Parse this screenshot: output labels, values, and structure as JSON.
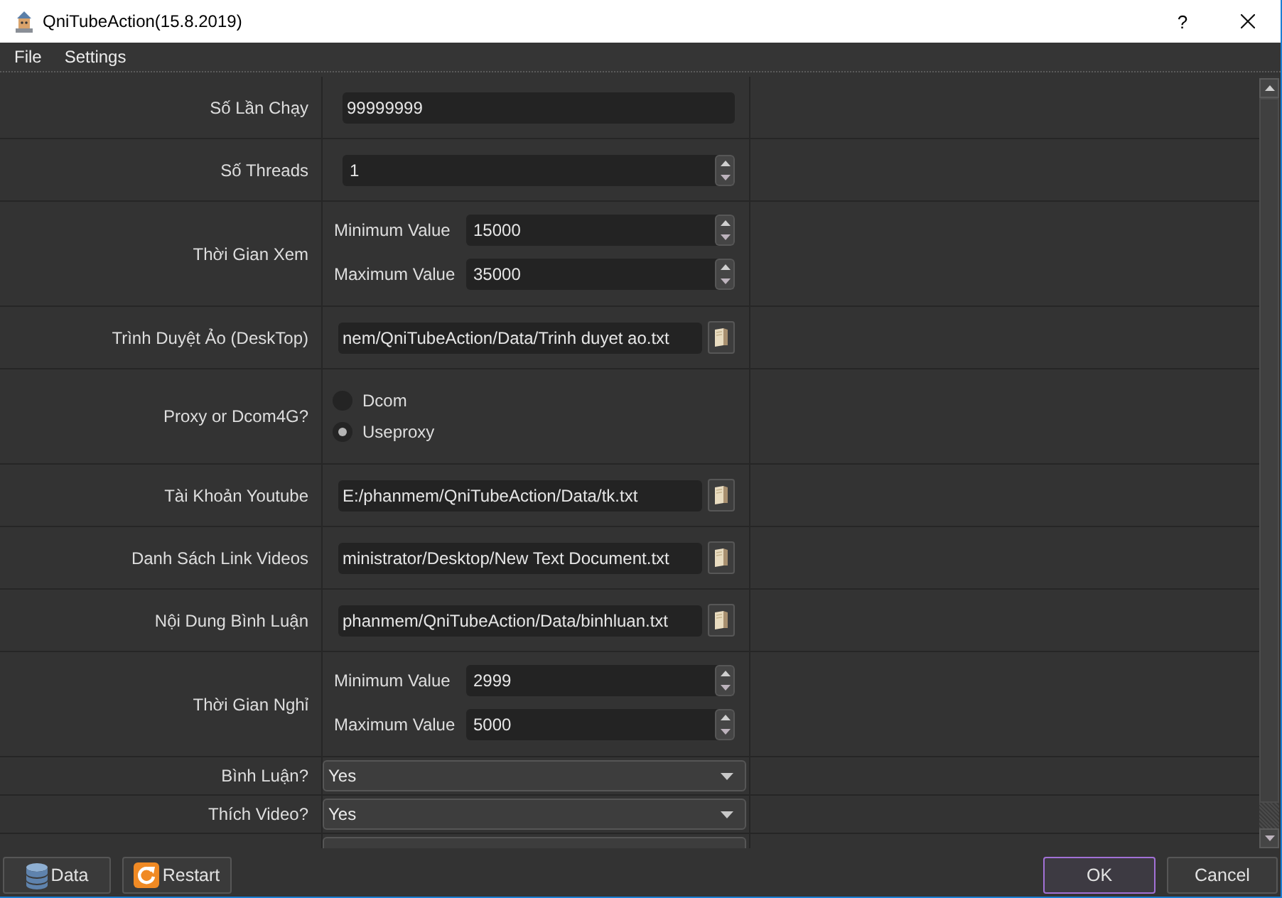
{
  "window": {
    "title": "QniTubeAction(15.8.2019)",
    "help": "?"
  },
  "menu": [
    {
      "label": "File"
    },
    {
      "label": "Settings"
    }
  ],
  "rows": [
    {
      "kind": "text",
      "label": "Số Lần Chạy",
      "value": "99999999"
    },
    {
      "kind": "spin",
      "label": "Số Threads",
      "value": "1"
    },
    {
      "kind": "range",
      "label": "Thời Gian Xem",
      "fields": [
        {
          "label": "Minimum Value",
          "value": "15000"
        },
        {
          "label": "Maximum Value",
          "value": "35000"
        }
      ]
    },
    {
      "kind": "file",
      "label": "Trình Duyệt Ảo (DeskTop)",
      "value": "nem/QniTubeAction/Data/Trinh duyet ao.txt"
    },
    {
      "kind": "radio",
      "label": "Proxy or Dcom4G?",
      "options": [
        {
          "label": "Dcom",
          "selected": false
        },
        {
          "label": "Useproxy",
          "selected": true
        }
      ]
    },
    {
      "kind": "file",
      "label": "Tài Khoản Youtube",
      "value": "E:/phanmem/QniTubeAction/Data/tk.txt"
    },
    {
      "kind": "file",
      "label": "Danh Sách Link Videos",
      "value": "ministrator/Desktop/New Text Document.txt"
    },
    {
      "kind": "file",
      "label": "Nội Dung Bình Luận",
      "value": "phanmem/QniTubeAction/Data/binhluan.txt"
    },
    {
      "kind": "range",
      "label": "Thời Gian Nghỉ",
      "fields": [
        {
          "label": "Minimum Value",
          "value": "2999"
        },
        {
          "label": "Maximum Value",
          "value": "5000"
        }
      ]
    },
    {
      "kind": "combo",
      "label": "Bình Luận?",
      "value": "Yes"
    },
    {
      "kind": "combo",
      "label": "Thích Video?",
      "value": "Yes"
    },
    {
      "kind": "combo"
    }
  ],
  "footer": {
    "left_buttons": [
      {
        "kind": "data",
        "label": "Data",
        "focused": false
      },
      {
        "kind": "restart",
        "label": "Restart",
        "focused": false
      }
    ],
    "right_buttons": [
      {
        "kind": "ok",
        "label": "OK",
        "focused": true
      },
      {
        "kind": "cancel",
        "label": "Cancel",
        "focused": false
      }
    ]
  }
}
